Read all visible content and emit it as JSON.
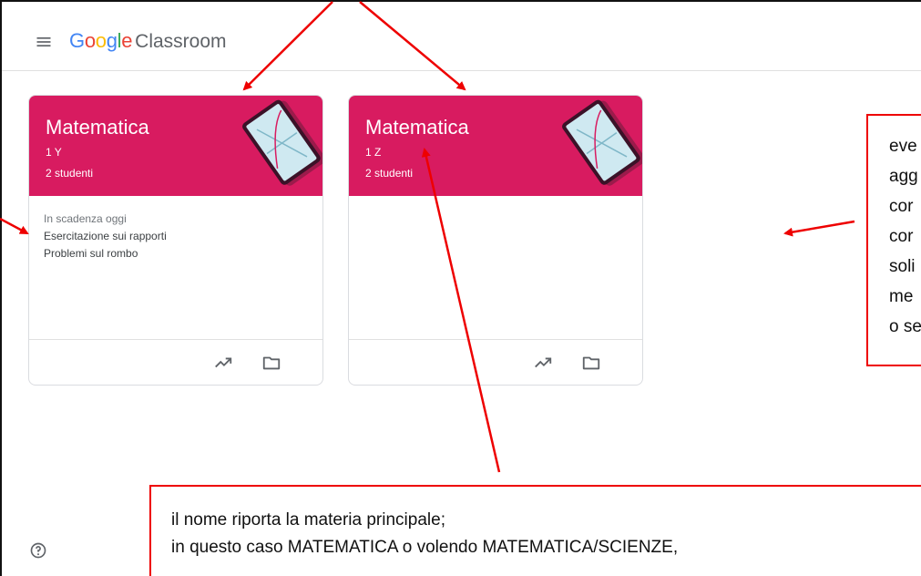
{
  "app": {
    "brand_google": [
      "G",
      "o",
      "o",
      "g",
      "l",
      "e"
    ],
    "brand_colors": [
      "#4285f4",
      "#ea4335",
      "#fbbc05",
      "#4285f4",
      "#34a853",
      "#ea4335"
    ],
    "product": "Classroom"
  },
  "theme": {
    "card_color": "#d81b60",
    "annotation_color": "#e00000"
  },
  "classes": [
    {
      "title": "Matematica",
      "section": "1 Y",
      "students": "2 studenti",
      "due_label": "In scadenza oggi",
      "due_items": [
        "Esercitazione sui rapporti",
        "Problemi sul rombo"
      ]
    },
    {
      "title": "Matematica",
      "section": "1 Z",
      "students": "2 studenti"
    }
  ],
  "icons": {
    "menu": "menu-icon",
    "trending": "trending-up-icon",
    "folder": "folder-icon",
    "help": "help-icon"
  },
  "annotations": {
    "right_note_lines": [
      "eve",
      "agg",
      "cor",
      "cor",
      "soli",
      "me",
      "o se"
    ],
    "bottom_note_lines": [
      "il nome riporta la materia principale;",
      "in questo caso MATEMATICA o volendo MATEMATICA/SCIENZE,"
    ]
  }
}
